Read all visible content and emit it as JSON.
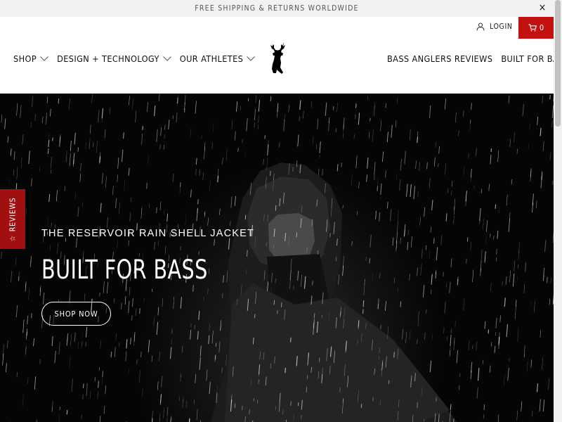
{
  "announcement": {
    "text": "Free shipping & returns worldwide",
    "close_label": "×"
  },
  "header": {
    "login_label": "Login",
    "cart_count": "0",
    "nav_left": [
      {
        "label": "Shop",
        "has_dropdown": true
      },
      {
        "label": "Design + Technology",
        "has_dropdown": true
      },
      {
        "label": "Our Athletes",
        "has_dropdown": true
      }
    ],
    "nav_right": [
      {
        "label": "Bass Anglers Reviews",
        "has_dropdown": false
      },
      {
        "label": "Built For Bass",
        "has_dropdown": true
      }
    ],
    "logo_icon": "deer-head-logo-icon"
  },
  "hero": {
    "subtitle": "The Reservoir Rain Shell Jacket",
    "title": "Built For Bass",
    "button_label": "Shop Now"
  },
  "reviews_tab": {
    "label": "Reviews",
    "icon": "star-icon"
  },
  "colors": {
    "accent": "#c1120f",
    "reviews_tab": "#a11010",
    "announcement_bg": "#f2f2f2"
  }
}
